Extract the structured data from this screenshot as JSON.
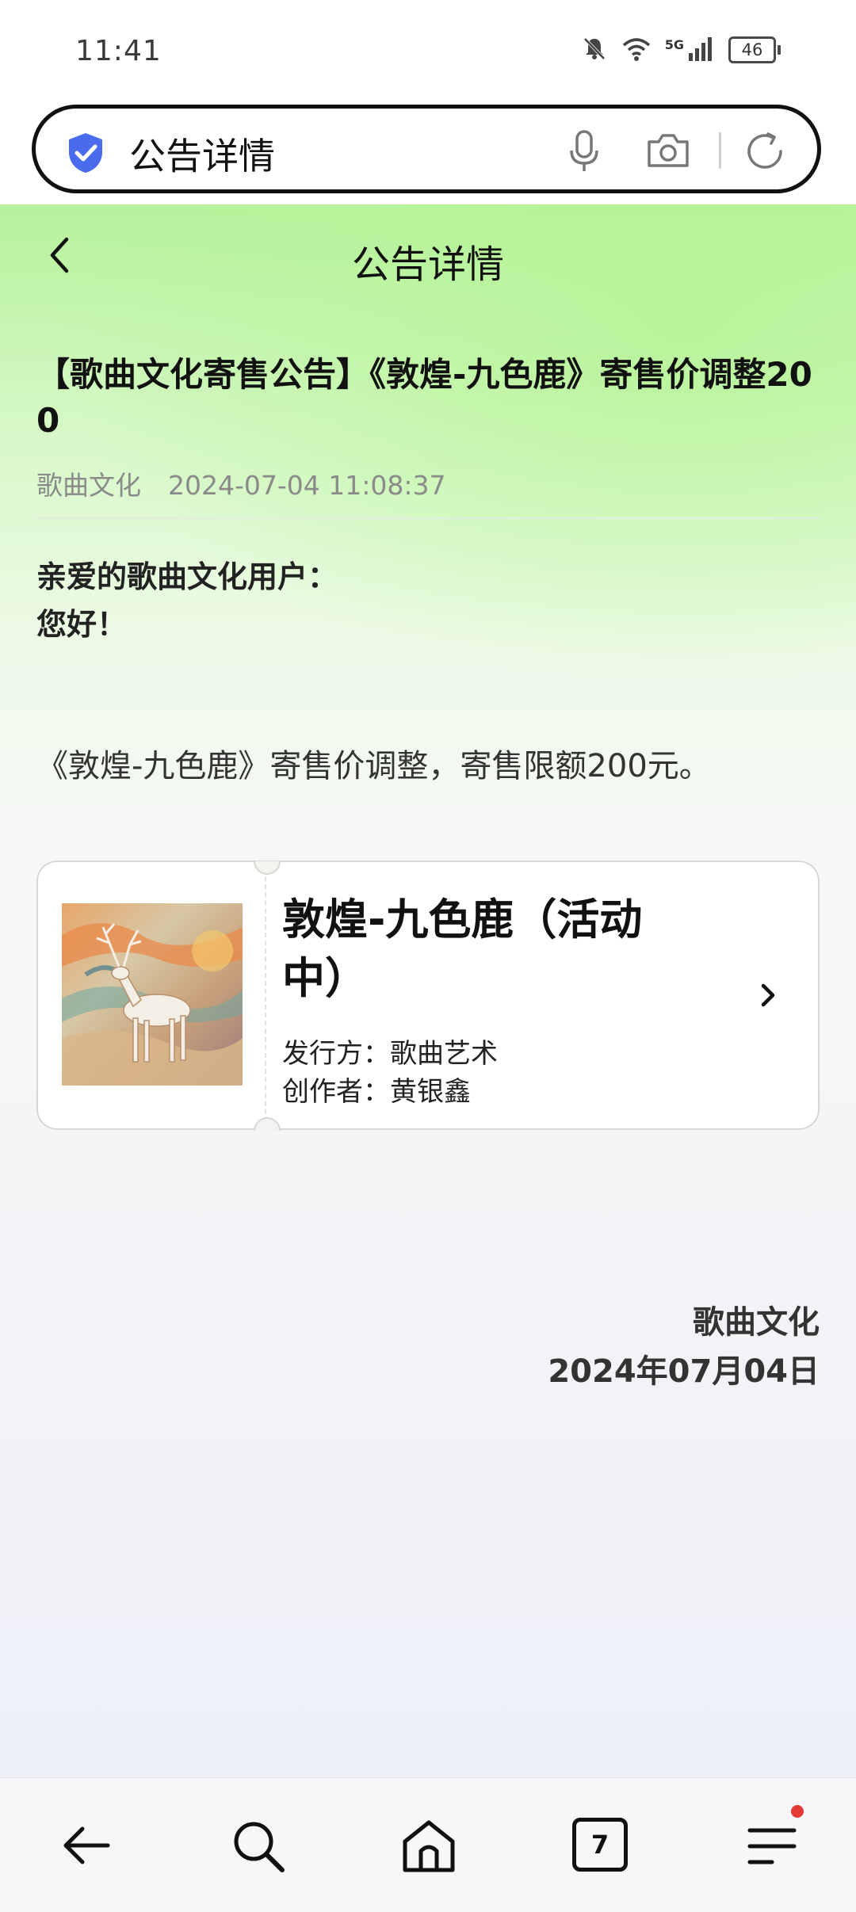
{
  "status_bar": {
    "time": "11:41",
    "network_label": "5G",
    "battery": "46",
    "icons": [
      "mute-bell-icon",
      "wifi-icon",
      "signal-icon",
      "battery-icon"
    ]
  },
  "address_bar": {
    "text": "公告详情",
    "icons": [
      "shield-check-icon",
      "mic-icon",
      "camera-icon",
      "refresh-icon"
    ],
    "shield_color": "#4b6bef"
  },
  "page": {
    "nav_title": "公告详情",
    "headline": "【歌曲文化寄售公告】《敦煌-九色鹿》寄售价调整200",
    "meta": {
      "source": "歌曲文化",
      "datetime": "2024-07-04 11:08:37"
    },
    "greeting": {
      "line1": "亲爱的歌曲文化用户：",
      "line2": "您好！"
    },
    "body": "《敦煌-九色鹿》寄售价调整，寄售限额200元。",
    "card": {
      "title": "敦煌-九色鹿（活动中）",
      "issuer_label": "发行方：",
      "issuer": "歌曲艺术",
      "creator_label": "创作者：",
      "creator": "黄银鑫"
    },
    "signature": {
      "name": "歌曲文化",
      "date": "2024年07月04日"
    }
  },
  "bottom_nav": {
    "tab_count": "7",
    "items": [
      "back-arrow-icon",
      "search-icon",
      "home-icon",
      "tabs-icon",
      "menu-icon"
    ],
    "badge_color": "#e53935"
  }
}
